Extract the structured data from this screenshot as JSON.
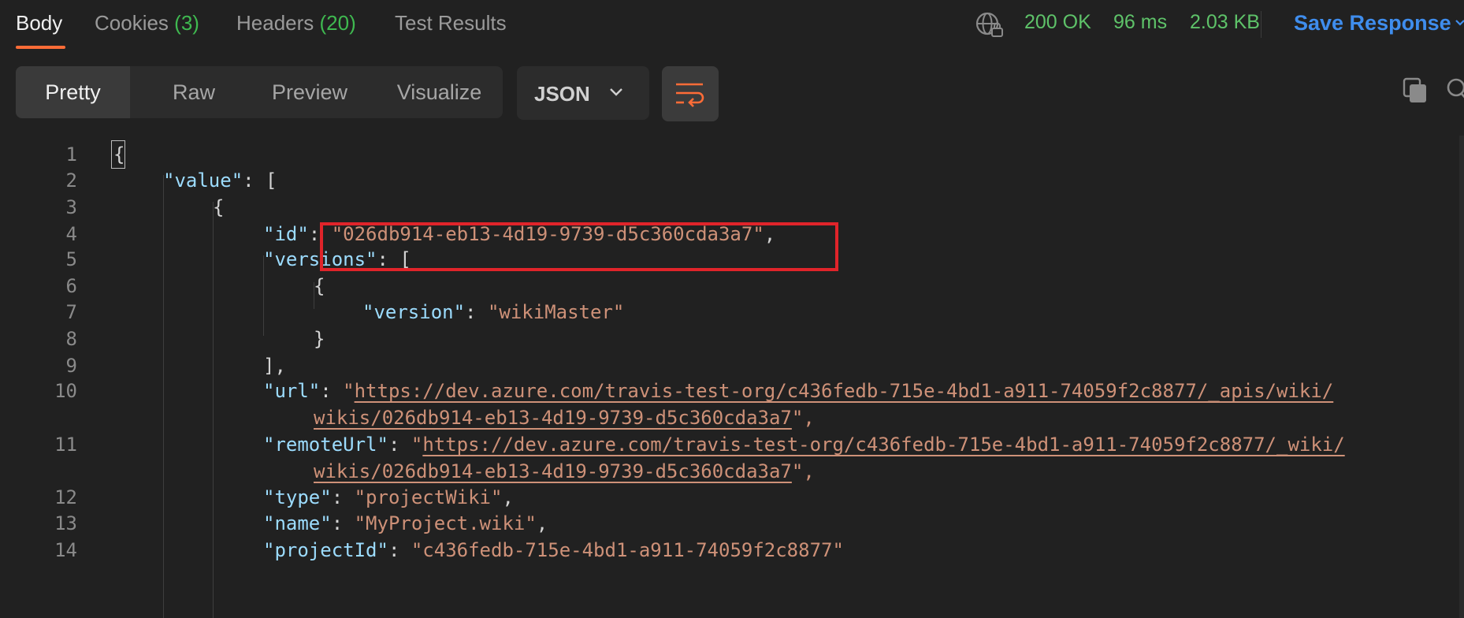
{
  "tabs": {
    "body": "Body",
    "cookies": "Cookies",
    "cookies_count": "(3)",
    "headers": "Headers",
    "headers_count": "(20)",
    "test_results": "Test Results"
  },
  "status": {
    "code": "200 OK",
    "time": "96 ms",
    "size": "2.03 KB",
    "save_label": "Save Response"
  },
  "toolbar": {
    "views": [
      "Pretty",
      "Raw",
      "Preview",
      "Visualize"
    ],
    "active_view": "Pretty",
    "format": "JSON"
  },
  "colors": {
    "accent": "#ff6c37",
    "status_green": "#5ec269",
    "save_blue": "#3f8ded",
    "json_key": "#9cdcfe",
    "json_string": "#ce9178",
    "highlight_box": "#e0242a"
  },
  "icons": {
    "globe": "globe-lock-icon",
    "wrap": "wrap-lines-icon",
    "copy": "copy-icon",
    "search": "search-icon"
  },
  "editor": {
    "line_numbers": [
      "1",
      "2",
      "3",
      "4",
      "5",
      "6",
      "7",
      "8",
      "9",
      "10",
      "11",
      "12",
      "13",
      "14"
    ],
    "l1": "{",
    "l2_key": "\"value\"",
    "l2_rest": ": [",
    "l3": "{",
    "l4_key": "\"id\"",
    "l4_colon": ": ",
    "l4_val": "\"026db914-eb13-4d19-9739-d5c360cda3a7\"",
    "l4_end": ",",
    "l5_key": "\"versions\"",
    "l5_rest": ": [",
    "l6": "{",
    "l7_key": "\"version\"",
    "l7_colon": ": ",
    "l7_val": "\"wikiMaster\"",
    "l8": "}",
    "l9": "],",
    "l10_key": "\"url\"",
    "l10_colon": ": ",
    "l10_q": "\"",
    "l10_link_a": "https://dev.azure.com/travis-test-org/c436fedb-715e-4bd1-a911-74059f2c8877/_apis/wiki/",
    "l10_link_b": "wikis/026db914-eb13-4d19-9739-d5c360cda3a7",
    "l10_end": "\",",
    "l11_key": "\"remoteUrl\"",
    "l11_colon": ": ",
    "l11_q": "\"",
    "l11_link_a": "https://dev.azure.com/travis-test-org/c436fedb-715e-4bd1-a911-74059f2c8877/_wiki/",
    "l11_link_b": "wikis/026db914-eb13-4d19-9739-d5c360cda3a7",
    "l11_end": "\",",
    "l12_key": "\"type\"",
    "l12_colon": ": ",
    "l12_val": "\"projectWiki\"",
    "l12_end": ",",
    "l13_key": "\"name\"",
    "l13_colon": ": ",
    "l13_val": "\"MyProject.wiki\"",
    "l13_end": ",",
    "l14_key": "\"projectId\"",
    "l14_colon": ": ",
    "l14_val": "\"c436fedb-715e-4bd1-a911-74059f2c8877\""
  }
}
